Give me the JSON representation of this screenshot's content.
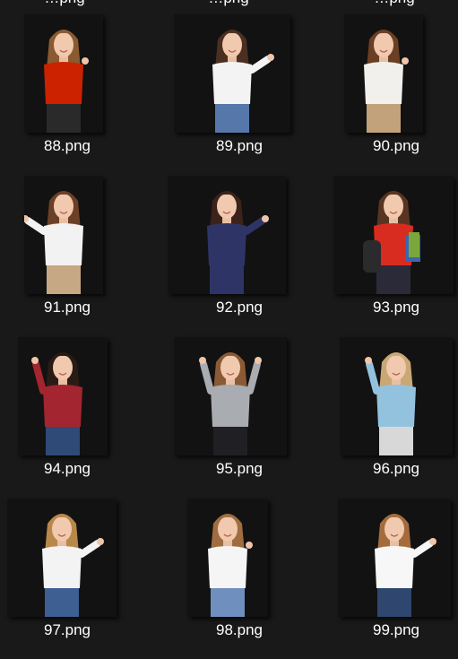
{
  "files": [
    {
      "name": "88.png",
      "top": "red-sleeveless",
      "topColor": "#cc2200",
      "bottom": "#2a2a2a",
      "hair": "#8a5a30",
      "pose": "thumbs-up"
    },
    {
      "name": "89.png",
      "top": "white-blouse",
      "topColor": "#f3f3f3",
      "bottom": "#5577aa",
      "hair": "#4a2f22",
      "pose": "pointing-right"
    },
    {
      "name": "90.png",
      "top": "white-blouse",
      "topColor": "#f1f0ec",
      "bottom": "#c2a27a",
      "hair": "#6a3f24",
      "pose": "ok-sign"
    },
    {
      "name": "91.png",
      "top": "white-blouse",
      "topColor": "#f2f2f2",
      "bottom": "#c7a884",
      "hair": "#6b4027",
      "pose": "pointing-left"
    },
    {
      "name": "92.png",
      "top": "navy-tank",
      "topColor": "#2e3566",
      "bottom": "#2e3566",
      "hair": "#3b221a",
      "pose": "pointing-right"
    },
    {
      "name": "93.png",
      "top": "red-cardigan",
      "topColor": "#d92c20",
      "bottom": "#2a2a38",
      "hair": "#5a3422",
      "pose": "books-and-backpack"
    },
    {
      "name": "94.png",
      "top": "plaid-shirt",
      "topColor": "#a22530",
      "bottom": "#2f4a76",
      "hair": "#2b1b15",
      "pose": "pointing-up-right"
    },
    {
      "name": "95.png",
      "top": "gray-sweater",
      "topColor": "#a9acb0",
      "bottom": "#1f1f24",
      "hair": "#8a5a35",
      "pose": "pointing-up-both"
    },
    {
      "name": "96.png",
      "top": "blue-shirt",
      "topColor": "#93c2de",
      "bottom": "#d8d8d8",
      "hair": "#c9a874",
      "pose": "pointing-up-left"
    },
    {
      "name": "97.png",
      "top": "white-tee",
      "topColor": "#f3f3f3",
      "bottom": "#3e5f92",
      "hair": "#b8884a",
      "pose": "pointing-right"
    },
    {
      "name": "98.png",
      "top": "white-tee",
      "topColor": "#f5f5f5",
      "bottom": "#6f8fbf",
      "hair": "#a06d40",
      "pose": "hand-on-hip"
    },
    {
      "name": "99.png",
      "top": "white-shirt",
      "topColor": "#f7f7f7",
      "bottom": "#2f466f",
      "hair": "#a46c3d",
      "pose": "pointing-right"
    }
  ],
  "partial_top_row": [
    "…png",
    "…png",
    "…png"
  ]
}
